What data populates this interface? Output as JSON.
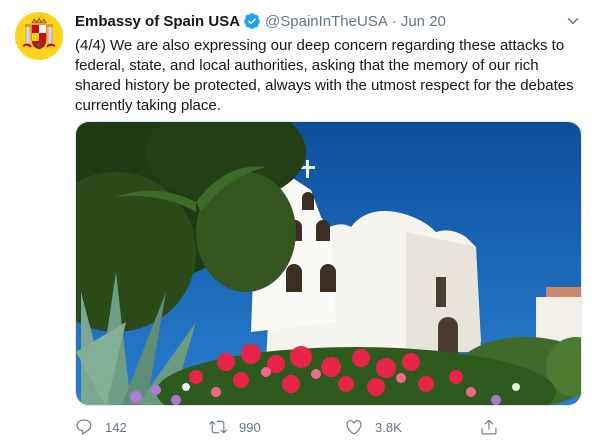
{
  "tweet": {
    "author_name": "Embassy of Spain USA",
    "handle": "@SpainInTheUSA",
    "separator": "·",
    "date": "Jun 20",
    "text": "(4/4) We are also expressing our deep concern regarding these attacks to federal, state, and local authorities, asking that the memory of our rich shared history be protected, always with the utmost respect for the debates currently taking place."
  },
  "actions": {
    "reply_count": "142",
    "retweet_count": "990",
    "like_count": "3.8K"
  },
  "colors": {
    "verified": "#1da1f2",
    "icon_gray": "#657786",
    "avatar_bg": "#ffd21f",
    "sky": "#1a66b8"
  },
  "icons": [
    "verified-badge-icon",
    "chevron-down-icon",
    "reply-icon",
    "retweet-icon",
    "like-icon",
    "share-icon"
  ]
}
